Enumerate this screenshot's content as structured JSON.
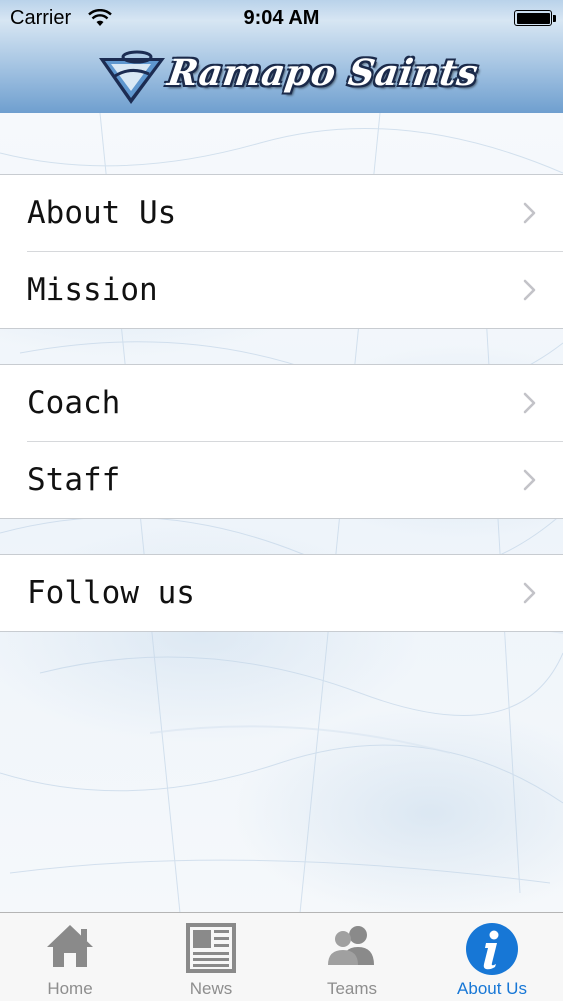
{
  "status_bar": {
    "carrier": "Carrier",
    "time": "9:04 AM"
  },
  "header": {
    "brand": "Ramapo Saints",
    "logo_icon": "saints-shield-logo"
  },
  "menu": {
    "groups": [
      {
        "items": [
          {
            "label": "About Us"
          },
          {
            "label": "Mission"
          }
        ]
      },
      {
        "items": [
          {
            "label": "Coach"
          },
          {
            "label": "Staff"
          }
        ]
      },
      {
        "items": [
          {
            "label": "Follow us"
          }
        ]
      }
    ]
  },
  "tabbar": {
    "tabs": [
      {
        "label": "Home",
        "icon": "home-icon"
      },
      {
        "label": "News",
        "icon": "news-icon"
      },
      {
        "label": "Teams",
        "icon": "teams-icon"
      },
      {
        "label": "About Us",
        "icon": "info-icon",
        "active": true
      }
    ]
  },
  "colors": {
    "accent": "#1777d6",
    "inactive": "#8e8e8e",
    "header_blue": "#6f9fcf"
  }
}
